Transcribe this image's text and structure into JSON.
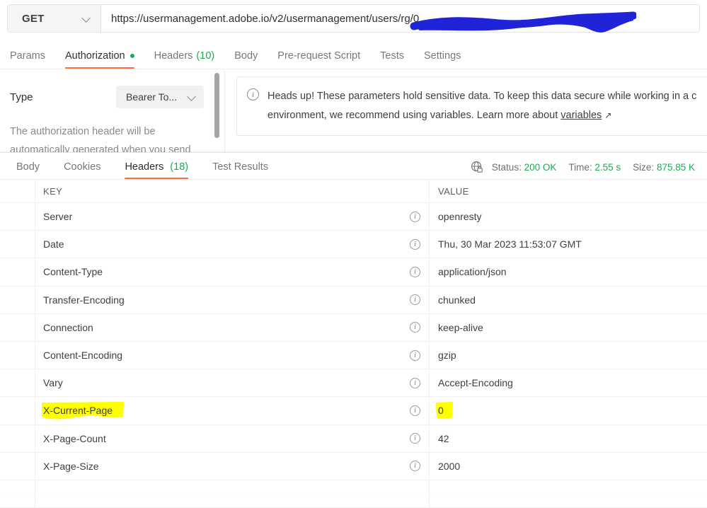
{
  "request": {
    "method": "GET",
    "url_prefix": "https://usermanagement.adobe.io/v2/usermanagement/users/",
    "url_redacted_tail": "rg/0",
    "redaction_color": "#1f24d8",
    "tabs": [
      {
        "label": "Params",
        "active": false,
        "dot": false,
        "count": null
      },
      {
        "label": "Authorization",
        "active": true,
        "dot": true,
        "count": null
      },
      {
        "label": "Headers",
        "active": false,
        "dot": false,
        "count": "(10)"
      },
      {
        "label": "Body",
        "active": false,
        "dot": false,
        "count": null
      },
      {
        "label": "Pre-request Script",
        "active": false,
        "dot": false,
        "count": null
      },
      {
        "label": "Tests",
        "active": false,
        "dot": false,
        "count": null
      },
      {
        "label": "Settings",
        "active": false,
        "dot": false,
        "count": null
      }
    ]
  },
  "authorization": {
    "type_label": "Type",
    "type_value": "Bearer To...",
    "description": "The authorization header will be automatically generated when you send",
    "banner": {
      "icon": "info-icon",
      "line1": "Heads up! These parameters hold sensitive data. To keep this data secure while working in a c",
      "line2_prefix": "environment, we recommend using variables. Learn more about ",
      "link": "variables",
      "external_arrow": "↗"
    }
  },
  "response": {
    "tabs": [
      {
        "label": "Body",
        "active": false,
        "count": null
      },
      {
        "label": "Cookies",
        "active": false,
        "count": null
      },
      {
        "label": "Headers",
        "active": true,
        "count": "(18)"
      },
      {
        "label": "Test Results",
        "active": false,
        "count": null
      }
    ],
    "meta": {
      "icon": "globe-lock-icon",
      "status_label": "Status:",
      "status_value": "200 OK",
      "time_label": "Time:",
      "time_value": "2.55 s",
      "size_label": "Size:",
      "size_value": "875.85 K",
      "value_color": "#1bab52"
    },
    "table": {
      "columns": [
        "KEY",
        "VALUE"
      ],
      "highlight_color": "#ffff00",
      "rows": [
        {
          "key": "Server",
          "value": "openresty",
          "highlight": false
        },
        {
          "key": "Date",
          "value": "Thu, 30 Mar 2023 11:53:07 GMT",
          "highlight": false
        },
        {
          "key": "Content-Type",
          "value": "application/json",
          "highlight": false
        },
        {
          "key": "Transfer-Encoding",
          "value": "chunked",
          "highlight": false
        },
        {
          "key": "Connection",
          "value": "keep-alive",
          "highlight": false
        },
        {
          "key": "Content-Encoding",
          "value": "gzip",
          "highlight": false
        },
        {
          "key": "Vary",
          "value": "Accept-Encoding",
          "highlight": false
        },
        {
          "key": "X-Current-Page",
          "value": "0",
          "highlight": true
        },
        {
          "key": "X-Page-Count",
          "value": "42",
          "highlight": false
        },
        {
          "key": "X-Page-Size",
          "value": "2000",
          "highlight": false
        }
      ]
    }
  }
}
